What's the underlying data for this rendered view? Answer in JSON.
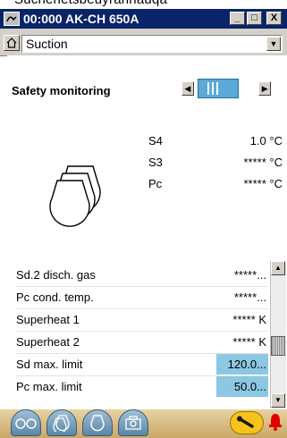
{
  "top_cut_text": "Suchenetsbeuyrannauqa",
  "window": {
    "title": "00:000 AK-CH 650A",
    "minimize": "_",
    "maximize": "□",
    "close": "X"
  },
  "menu": {
    "selected_view": "Suction"
  },
  "section": {
    "title": "Safety monitoring"
  },
  "readings": [
    {
      "label": "S4",
      "value": "1.0 °C"
    },
    {
      "label": "S3",
      "value": "***** °C"
    },
    {
      "label": "Pc",
      "value": "***** °C"
    }
  ],
  "parameters": [
    {
      "name": "Sd.2 disch. gas",
      "value": "*****...",
      "editable": false
    },
    {
      "name": "Pc cond. temp.",
      "value": "*****...",
      "editable": false
    },
    {
      "name": "Superheat 1",
      "value": "***** K",
      "editable": false
    },
    {
      "name": "Superheat 2",
      "value": "***** K",
      "editable": false
    },
    {
      "name": "Sd max. limit",
      "value": "120.0...",
      "editable": true
    },
    {
      "name": "Pc max. limit",
      "value": "50.0...",
      "editable": true
    }
  ],
  "colors": {
    "title_bar": "#0a246a",
    "edit_field": "#8cc7e3",
    "page_indicator": "#5aa9d6",
    "bottom_bar": "#caa767",
    "alarm": "#e00000"
  },
  "bottom_icons": [
    "compressors-tab-icon",
    "compressor-pack-tab-icon",
    "compressor-tab-icon",
    "camera-tab-icon",
    "wrench-icon",
    "alarm-bell-icon"
  ]
}
